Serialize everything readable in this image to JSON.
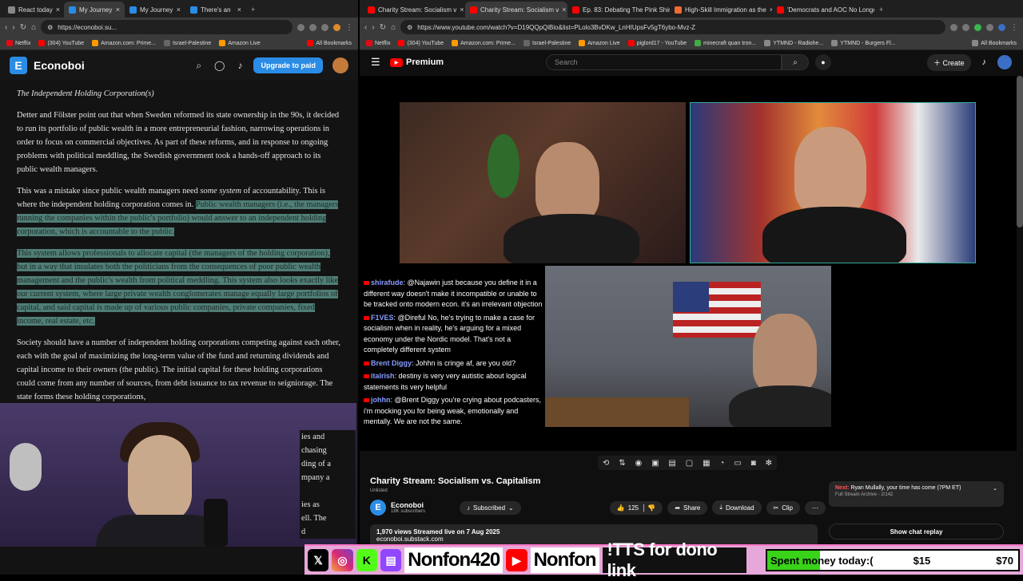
{
  "left_browser": {
    "tabs": [
      {
        "title": "React today",
        "color": "#888888",
        "active": false
      },
      {
        "title": "My Journey",
        "color": "#2b8ce6",
        "active": true
      },
      {
        "title": "My Journey",
        "color": "#2b8ce6",
        "active": false
      },
      {
        "title": "There's an",
        "color": "#2b8ce6",
        "active": false
      }
    ],
    "url": "https://econoboi.su...",
    "bookmarks": [
      "Netflix",
      "(304) YouTube",
      "Amazon.com: Prime...",
      "Israel-Palestine",
      "Amazon Live",
      "All Bookmarks"
    ]
  },
  "substack": {
    "name": "Econoboi",
    "logo_letter": "E",
    "upgrade_label": "Upgrade to paid",
    "heading": "The Independent Holding Corporation(s)",
    "p1": "Detter and Fölster point out that when Sweden reformed its state ownership in the 90s, it decided to run its portfolio of public wealth in a more entrepreneurial fashion, narrowing operations in order to focus on commercial objectives. As part of these reforms, and in response to ongoing problems with political meddling, the Swedish government took a hands-off approach to its public wealth managers.",
    "p2_a": "This was a mistake since public wealth managers need ",
    "p2_em": "some system",
    "p2_b": " of accountability. This is where the independent holding corporation comes in. ",
    "p2_hl": "Public wealth managers (i.e., the managers running the companies within the public's portfolio) would answer to an independent holding corporation, which is accountable to the public.",
    "p3_hl1": "This system allows professionals to allocate capital (the managers of the holding corporation), but in a way that insulates both the politicians from the consequences of poor public wealth management and the public's wealth from political meddling.",
    "p3_hl2": " This system also looks exactly like our current system, where large private wealth conglomerates manage equally large portfolios of capital, and said capital is made up of various public companies, private companies, fixed income, real estate, etc.",
    "p4": "Society should have a number of independent holding corporations competing against each other, each with the goal of maximizing the long-term value of the fund and returning dividends and capital income to their owners (the public). The initial capital for these holding corporations could come from any number of sources, from debt issuance to tax revenue to seigniorage. The state forms these holding corporations,",
    "p4_tail": [
      "ies and",
      "chasing",
      "ding of a",
      "mpany a",
      "ies as",
      "ell. The",
      "d"
    ]
  },
  "right_browser": {
    "tabs": [
      {
        "title": "Charity Stream: Socialism v",
        "color": "#ff0000",
        "active": false
      },
      {
        "title": "Charity Stream: Socialism v",
        "color": "#ff0000",
        "active": true
      },
      {
        "title": "Ep. 83: Debating The Pink Shir",
        "color": "#ff0000",
        "active": false
      },
      {
        "title": "High-Skill Immigration as the",
        "color": "#f06a35",
        "active": false
      },
      {
        "title": "'Democrats and AOC No Longe",
        "color": "#ff0000",
        "active": false
      }
    ],
    "url": "https://www.youtube.com/watch?v=D19QQpQiBio&list=PLolo3BvDKw_LnHIUpsFv5gT6ybo-Mvz-Z",
    "bookmarks": [
      "Netflix",
      "(304) YouTube",
      "Amazon.com: Prime...",
      "Israel-Palestine",
      "Amazon Live",
      "piglord17 - YouTube",
      "minecraft quan tron...",
      "YTMND - Radiohe...",
      "YTMND - Burgers Fl...",
      "All Bookmarks"
    ]
  },
  "youtube": {
    "logo_text": "Premium",
    "search_placeholder": "Search",
    "create_label": "Create",
    "chat": [
      {
        "user": "shirafude",
        "color": "#8a9cff",
        "text": "@Najawin just because you define it in a different way doesn't make it incompatible or unable to be tracked onto modern econ. it's an irrelevant objection"
      },
      {
        "user": "F1VES",
        "color": "#8a9cff",
        "text": "@Direful No, he's trying to make a case for socialism when in reality, he's arguing for a mixed economy under the Nordic model. That's not a completely different system"
      },
      {
        "user": "Brent Diggy",
        "color": "#8a9cff",
        "text": "Johhn is cringe af, are you old?"
      },
      {
        "user": "italrish",
        "color": "#8a9cff",
        "text": "destiny is very very autistic about logical statements its very helpful"
      },
      {
        "user": "johhn",
        "color": "#8a9cff",
        "text": "@Brent Diggy you're crying about podcasters, i'm mocking you for being weak, emotionally and mentally. We are not the same."
      }
    ],
    "video_title": "Charity Stream: Socialism vs. Capitalism",
    "unlisted": "Unlisted",
    "channel_name": "Econoboi",
    "channel_subs": "18K subscribers",
    "subscribed_label": "Subscribed",
    "likes": "125",
    "share_label": "Share",
    "download_label": "Download",
    "clip_label": "Clip",
    "views_line": "1,970 views  Streamed live on 7 Aug 2025",
    "desc_line2": "econoboi.substack.com",
    "next_label": "Next:",
    "next_title": "Ryan Mullally, your time has come (7PM ET)",
    "next_sub": "Full Stream Archive - 2/142",
    "show_chat_label": "Show chat replay"
  },
  "overlay": {
    "handle1": "Nonfon420",
    "handle2": "Nonfon",
    "tts": "!TTS for dono link",
    "goal_label": "Spent money today:(",
    "goal_current": "$15",
    "goal_target": "$70",
    "goal_progress": 0.21
  }
}
